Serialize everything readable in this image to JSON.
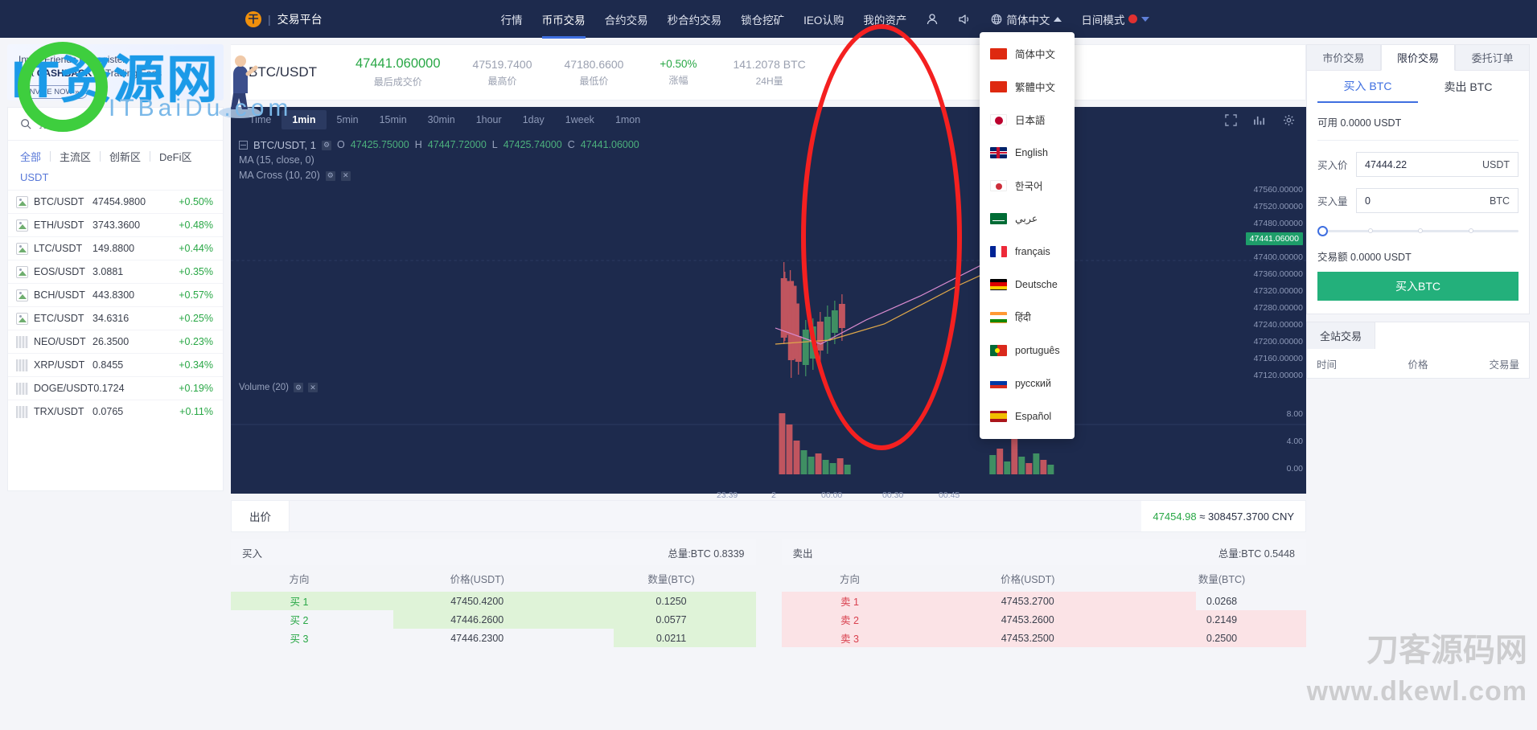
{
  "header": {
    "brand_symbol": "干",
    "brand_separator": "|",
    "brand_name": "交易平台",
    "nav": [
      {
        "label": "行情",
        "active": false
      },
      {
        "label": "币币交易",
        "active": true
      },
      {
        "label": "合约交易",
        "active": false
      },
      {
        "label": "秒合约交易",
        "active": false
      },
      {
        "label": "锁仓挖矿",
        "active": false
      },
      {
        "label": "IEO认购",
        "active": false
      },
      {
        "label": "我的资产",
        "active": false
      }
    ],
    "user_icon": "user-icon",
    "sound_icon": "speaker-icon",
    "language_label": "简体中文",
    "language_icon": "globe-icon",
    "mode_label": "日间模式",
    "mode_icon": "sun-icon"
  },
  "language_menu": {
    "items": [
      {
        "label": "简体中文",
        "flag": "cn"
      },
      {
        "label": "繁體中文",
        "flag": "hk"
      },
      {
        "label": "日本語",
        "flag": "jp"
      },
      {
        "label": "English",
        "flag": "gb"
      },
      {
        "label": "한국어",
        "flag": "kr"
      },
      {
        "label": "عربي",
        "flag": "sa"
      },
      {
        "label": "français",
        "flag": "fr"
      },
      {
        "label": "Deutsche",
        "flag": "de"
      },
      {
        "label": "हिंदी",
        "flag": "in"
      },
      {
        "label": "português",
        "flag": "pt"
      },
      {
        "label": "русский",
        "flag": "ru"
      },
      {
        "label": "Español",
        "flag": "es"
      }
    ]
  },
  "promo": {
    "line1": "Invite Friends to Register",
    "line2_a": "Get ",
    "line2_b": "CASHBACK",
    "line2_c": " of Trading Fees",
    "button": "INVITE NOW  »"
  },
  "market": {
    "search_placeholder": "打字",
    "search_icon": "search-icon",
    "categories": [
      {
        "label": "全部",
        "active": true
      },
      {
        "label": "主流区",
        "active": false
      },
      {
        "label": "创新区",
        "active": false
      },
      {
        "label": "DeFi区",
        "active": false
      }
    ],
    "sub_tab": "USDT",
    "coins": [
      {
        "pair": "BTC/USDT",
        "price": "47454.9800",
        "change": "+0.50%",
        "icon": "broken"
      },
      {
        "pair": "ETH/USDT",
        "price": "3743.3600",
        "change": "+0.48%",
        "icon": "broken"
      },
      {
        "pair": "LTC/USDT",
        "price": "149.8800",
        "change": "+0.44%",
        "icon": "broken"
      },
      {
        "pair": "EOS/USDT",
        "price": "3.0881",
        "change": "+0.35%",
        "icon": "broken"
      },
      {
        "pair": "BCH/USDT",
        "price": "443.8300",
        "change": "+0.57%",
        "icon": "broken"
      },
      {
        "pair": "ETC/USDT",
        "price": "34.6316",
        "change": "+0.25%",
        "icon": "broken"
      },
      {
        "pair": "NEO/USDT",
        "price": "26.3500",
        "change": "+0.23%",
        "icon": "noimg"
      },
      {
        "pair": "XRP/USDT",
        "price": "0.8455",
        "change": "+0.34%",
        "icon": "noimg"
      },
      {
        "pair": "DOGE/USDT",
        "price": "0.1724",
        "change": "+0.19%",
        "icon": "noimg"
      },
      {
        "pair": "TRX/USDT",
        "price": "0.0765",
        "change": "+0.11%",
        "icon": "noimg"
      }
    ]
  },
  "ticker": {
    "pair": "BTC/USDT",
    "stats": [
      {
        "value": "47441.060000",
        "label": "最后成交价",
        "style": "big"
      },
      {
        "value": "47519.7400",
        "label": "最高价",
        "style": "plain"
      },
      {
        "value": "47180.6600",
        "label": "最低价",
        "style": "plain"
      },
      {
        "value": "+0.50%",
        "label": "涨幅",
        "style": "up"
      },
      {
        "value": "141.2078 BTC",
        "label": "24H量",
        "style": "plain"
      }
    ]
  },
  "chart": {
    "timeframes": [
      {
        "label": "Time",
        "active": false
      },
      {
        "label": "1min",
        "active": true
      },
      {
        "label": "5min",
        "active": false
      },
      {
        "label": "15min",
        "active": false
      },
      {
        "label": "30min",
        "active": false
      },
      {
        "label": "1hour",
        "active": false
      },
      {
        "label": "1day",
        "active": false
      },
      {
        "label": "1week",
        "active": false
      },
      {
        "label": "1mon",
        "active": false
      }
    ],
    "tools": [
      "fullscreen-icon",
      "indicator-icon",
      "settings-icon"
    ],
    "symbol_legend": "BTC/USDT, 1",
    "ohlc": {
      "o_key": "O",
      "o": "47425.75000",
      "h_key": "H",
      "h": "47447.72000",
      "l_key": "L",
      "l": "47425.74000",
      "c_key": "C",
      "c": "47441.06000"
    },
    "ma_label": "MA (15, close, 0)",
    "ma_cross_label": "MA Cross (10, 20)",
    "volume_label": "Volume (20)",
    "last_price_tag": "47441.06000",
    "y_labels": [
      "47560.00000",
      "47520.00000",
      "47480.00000",
      "47440.00000",
      "47400.00000",
      "47360.00000",
      "47320.00000",
      "47280.00000",
      "47240.00000",
      "47200.00000",
      "47160.00000",
      "47120.00000"
    ],
    "vol_y_labels": [
      "8.00",
      "4.00",
      "0.00"
    ],
    "x_labels": [
      "23:39",
      "2",
      "00:00",
      "00:30",
      "00:45"
    ]
  },
  "orderbook": {
    "bid_tab": "出价",
    "last_price": "47454.98",
    "approx": "≈ 308457.3700 CNY",
    "buy": {
      "title": "买入",
      "total": "总量:BTC 0.8339",
      "columns": [
        "方向",
        "价格(USDT)",
        "数量(BTC)"
      ],
      "rows": [
        {
          "dir": "买 1",
          "price": "47450.4200",
          "amount": "0.1250",
          "depth": 100
        },
        {
          "dir": "买 2",
          "price": "47446.2600",
          "amount": "0.0577",
          "depth": 69
        },
        {
          "dir": "买 3",
          "price": "47446.2300",
          "amount": "0.0211",
          "depth": 41
        }
      ]
    },
    "sell": {
      "title": "卖出",
      "total": "总量:BTC 0.5448",
      "columns": [
        "方向",
        "价格(USDT)",
        "数量(BTC)"
      ],
      "rows": [
        {
          "dir": "卖 1",
          "price": "47453.2700",
          "amount": "0.0268",
          "depth": 80
        },
        {
          "dir": "卖 2",
          "price": "47453.2600",
          "amount": "0.2149",
          "depth": 100
        },
        {
          "dir": "卖 3",
          "price": "47453.2500",
          "amount": "0.2500",
          "depth": 100
        }
      ]
    }
  },
  "trade": {
    "tabs": [
      {
        "label": "市价交易",
        "active": false
      },
      {
        "label": "限价交易",
        "active": true
      },
      {
        "label": "委托订单",
        "active": false
      }
    ],
    "side_tabs": [
      {
        "label": "买入 BTC",
        "active": true
      },
      {
        "label": "卖出 BTC",
        "active": false
      }
    ],
    "available": "可用 0.0000 USDT",
    "price_label": "买入价",
    "price_value": "47444.22",
    "price_unit": "USDT",
    "amount_label": "买入量",
    "amount_value": "0",
    "amount_unit": "BTC",
    "total_text": "交易额 0.0000 USDT",
    "submit_label": "买入BTC",
    "submit_color": "#23b07b"
  },
  "recent_trades": {
    "tab": "全站交易",
    "columns": [
      "时间",
      "价格",
      "交易量"
    ]
  },
  "watermarks": {
    "it_text": "IT资源网",
    "it_sub": "ITBaiDu.com",
    "dk_text": "刀客源码网",
    "dk_url": "www.dkewl.com"
  }
}
